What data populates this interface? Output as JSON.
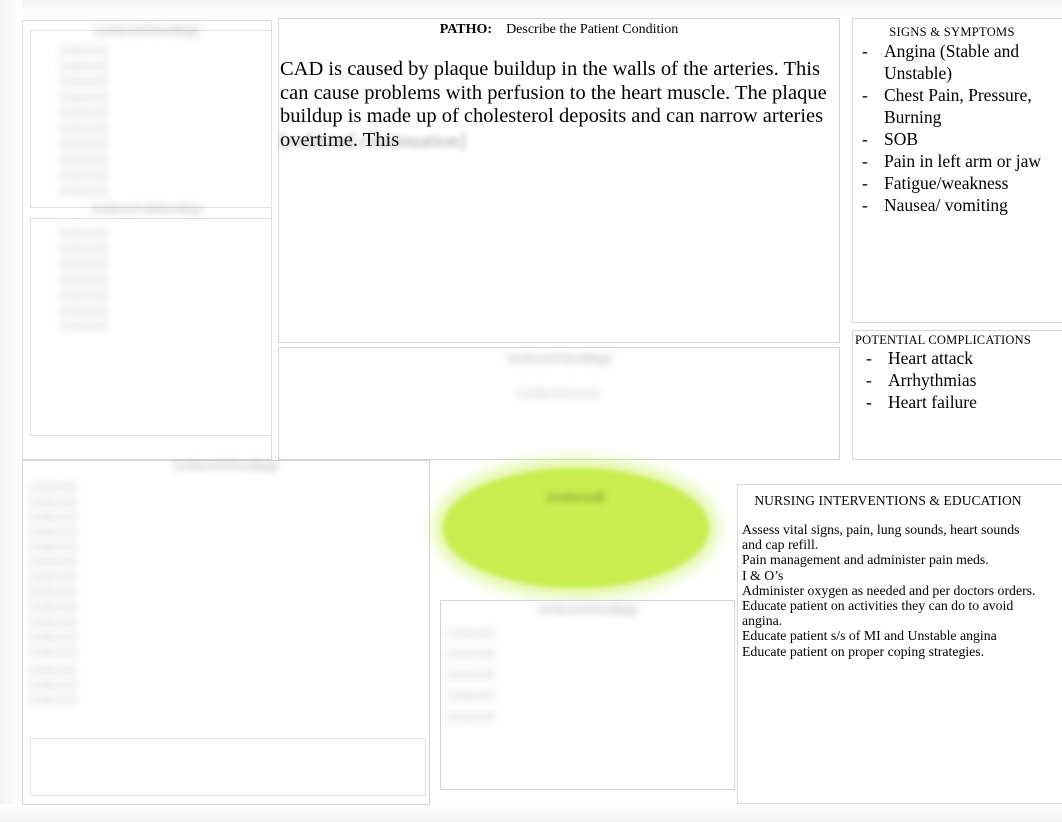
{
  "document": {
    "type": "nursing-concept-map",
    "topic": "CAD"
  },
  "top_left": {
    "title": "[redacted heading]",
    "subtitle": "[redacted subheading]",
    "lines_a": [
      "[redacted]",
      "[redacted]",
      "[redacted]",
      "[redacted]",
      "[redacted]",
      "[redacted]",
      "[redacted]",
      "[redacted]",
      "[redacted]",
      "[redacted]"
    ],
    "lines_b": [
      "[redacted]",
      "[redacted]",
      "[redacted]",
      "[redacted]",
      "[redacted]",
      "[redacted]",
      "[redacted]"
    ]
  },
  "patho": {
    "label": "PATHO:",
    "heading": "Describe the Patient Condition",
    "body": "CAD is caused by plaque buildup in the walls of the arteries. This can cause problems with perfusion to the heart muscle. The plaque buildup is made up of cholesterol deposits and can narrow arteries overtime. This",
    "body_tail": "[redacted continuation]"
  },
  "middle": {
    "heading": "[redacted heading]",
    "subtext": "[redacted text]"
  },
  "signs_symptoms": {
    "heading": "SIGNS & SYMPTOMS",
    "bullet": "-",
    "items": [
      "Angina (Stable and Unstable)",
      "Chest Pain, Pressure, Burning",
      "SOB",
      "Pain in left arm or jaw",
      "Fatigue/weakness",
      "Nausea/ vomiting"
    ]
  },
  "potential_complications": {
    "heading": "POTENTIAL COMPLICATIONS",
    "bullet": "-",
    "items": [
      "Heart attack",
      "Arrhythmias",
      "Heart failure"
    ]
  },
  "bottom_left": {
    "heading": "[redacted heading]",
    "lines": [
      "[redacted]",
      "[redacted]",
      "[redacted]",
      "[redacted]",
      "[redacted]",
      "[redacted]",
      "[redacted]",
      "[redacted]",
      "[redacted]",
      "[redacted]",
      "[redacted]",
      "[redacted]"
    ],
    "lines2": [
      "[redacted]",
      "[redacted]",
      "[redacted]"
    ]
  },
  "center_ellipse": {
    "text": "[redacted]",
    "color": "#c8ee50"
  },
  "bottom_middle": {
    "heading": "[redacted heading]",
    "lines": [
      "[redacted]",
      "[redacted]",
      "[redacted]",
      "[redacted]",
      "[redacted]"
    ]
  },
  "nursing": {
    "heading": "NURSING INTERVENTIONS & EDUCATION",
    "items": [
      "Assess vital signs, pain, lung sounds, heart sounds and cap refill.",
      "Pain management and administer pain meds.",
      "I & O’s",
      "Administer oxygen as needed and per doctors orders.",
      "Educate patient on activities they can do to avoid angina.",
      "Educate patient s/s of MI and Unstable angina",
      "Educate patient on proper coping strategies."
    ]
  }
}
